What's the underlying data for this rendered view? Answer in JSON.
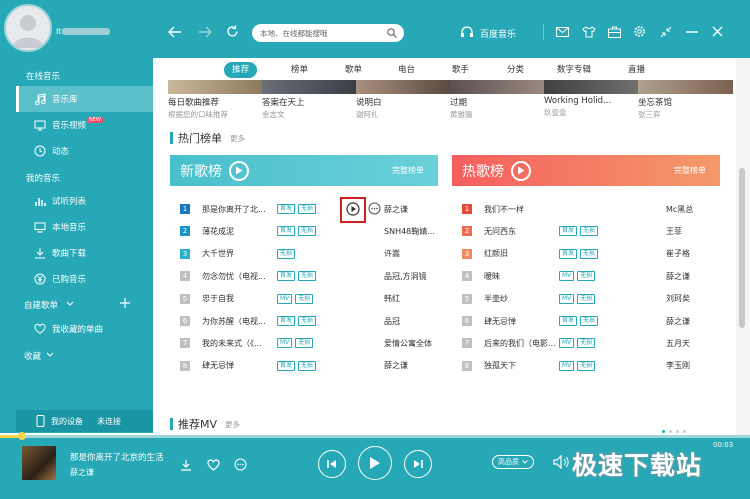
{
  "user": {
    "name": "It"
  },
  "nav": {
    "search_placeholder": "本地、在线都能搜哦",
    "brand": "百度音乐"
  },
  "sidebar": {
    "sections": {
      "online": "在线音乐",
      "mine": "我的音乐",
      "custom": "自建歌单",
      "collect": "收藏"
    },
    "items": [
      {
        "label": "音乐库",
        "icon": "music-note-icon"
      },
      {
        "label": "音乐视频",
        "icon": "tv-icon",
        "badge": "NEW"
      },
      {
        "label": "动态",
        "icon": "dynamic-icon"
      },
      {
        "label": "试听列表",
        "icon": "bars-icon"
      },
      {
        "label": "本地音乐",
        "icon": "computer-icon"
      },
      {
        "label": "歌曲下载",
        "icon": "download-icon"
      },
      {
        "label": "已购音乐",
        "icon": "yuan-icon"
      },
      {
        "label": "我收藏的单曲",
        "icon": "heart-icon"
      }
    ],
    "device": "我的设备",
    "device_status": "未连接"
  },
  "tabs": [
    "推荐",
    "榜单",
    "歌单",
    "电台",
    "歌手",
    "分类",
    "数字专辑",
    "直播"
  ],
  "cards": [
    {
      "title": "每日歌曲推荐",
      "sub": "根据您的口味推荐"
    },
    {
      "title": "答案在天上",
      "sub": "金志文"
    },
    {
      "title": "说明白",
      "sub": "谢阿扎"
    },
    {
      "title": "过期",
      "sub": "黄雅骊"
    },
    {
      "title": "Working Holid...",
      "sub": "玖壹壹"
    },
    {
      "title": "坐忘茶馆",
      "sub": "张三弈"
    }
  ],
  "hot": {
    "title": "热门榜单",
    "more": "更多"
  },
  "mv": {
    "title": "推荐MV",
    "more": "更多"
  },
  "new_chart": {
    "name": "新歌榜",
    "full": "完整榜单",
    "rows": [
      {
        "rank": "1",
        "title": "那是你离开了北...",
        "tags": [
          "首发",
          "无损"
        ],
        "artist": "薛之谦"
      },
      {
        "rank": "2",
        "title": "薄花成泥",
        "tags": [
          "首发",
          "无损"
        ],
        "artist": "SNH48鞠婧..."
      },
      {
        "rank": "3",
        "title": "大千世界",
        "tags": [
          "无损"
        ],
        "artist": "许嵩"
      },
      {
        "rank": "4",
        "title": "勿念勿忧（电视...",
        "tags": [
          "首发",
          "无损"
        ],
        "artist": "品冠,方洞镜"
      },
      {
        "rank": "5",
        "title": "忠于自我",
        "tags": [
          "MV",
          "无损"
        ],
        "artist": "韩红"
      },
      {
        "rank": "6",
        "title": "为你苏醒（电视...",
        "tags": [
          "首发",
          "无损"
        ],
        "artist": "品冠"
      },
      {
        "rank": "7",
        "title": "我的未来式（《...",
        "tags": [
          "MV",
          "无损"
        ],
        "artist": "爱情公寓全体"
      },
      {
        "rank": "8",
        "title": "肆无忌惮",
        "tags": [
          "首发",
          "无损"
        ],
        "artist": "薛之谦"
      }
    ]
  },
  "hot_chart": {
    "name": "热歌榜",
    "full": "完整榜单",
    "rows": [
      {
        "rank": "1",
        "title": "我们不一样",
        "tags": [],
        "artist": "Mc黑总"
      },
      {
        "rank": "2",
        "title": "无问西东",
        "tags": [
          "首发",
          "无损"
        ],
        "artist": "王菲"
      },
      {
        "rank": "3",
        "title": "红颜旧",
        "tags": [
          "首发",
          "无损"
        ],
        "artist": "崔子格"
      },
      {
        "rank": "4",
        "title": "暧昧",
        "tags": [
          "MV",
          "无损"
        ],
        "artist": "薛之谦"
      },
      {
        "rank": "5",
        "title": "半壶纱",
        "tags": [
          "MV",
          "无损"
        ],
        "artist": "刘珂矣"
      },
      {
        "rank": "6",
        "title": "肆无忌惮",
        "tags": [
          "首发",
          "无损"
        ],
        "artist": "薛之谦"
      },
      {
        "rank": "7",
        "title": "后来的我们（电影...",
        "tags": [
          "MV",
          "无损"
        ],
        "artist": "五月天"
      },
      {
        "rank": "8",
        "title": "独孤天下",
        "tags": [
          "MV",
          "无损"
        ],
        "artist": "李玉刚"
      }
    ]
  },
  "player": {
    "song": "那是你离开了北京的生活",
    "artist": "薛之谦",
    "time": "00:03",
    "quality": "高品质"
  },
  "watermark": "极速下载站",
  "colors": {
    "accent": "#27a8b6",
    "new_chart": "#4ec3cf",
    "hot_chart": "#f36b5e",
    "highlight": "#d02020"
  }
}
